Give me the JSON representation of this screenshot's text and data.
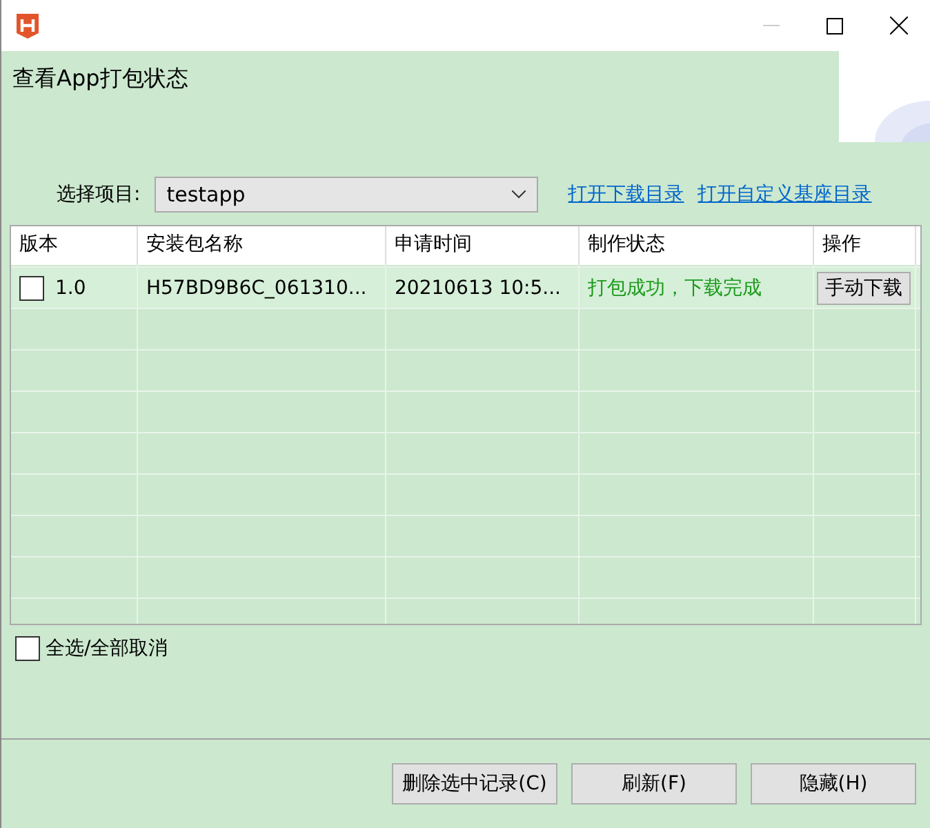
{
  "window": {
    "title": "查看App打包状态"
  },
  "project": {
    "label": "选择项目:",
    "value": "testapp"
  },
  "links": [
    "打开下载目录",
    "打开自定义基座目录"
  ],
  "table": {
    "columns": [
      "版本",
      "安装包名称",
      "申请时间",
      "制作状态",
      "操作"
    ],
    "rows": [
      {
        "checked": false,
        "version": "1.0",
        "package": "H57BD9B6C_061310...",
        "time": "20210613 10:5...",
        "status": "打包成功，下载完成",
        "action": "手动下载"
      }
    ]
  },
  "select_all": {
    "label": "全选/全部取消",
    "checked": false
  },
  "buttons": [
    "删除选中记录(C)",
    "刷新(F)",
    "隐藏(H)"
  ]
}
